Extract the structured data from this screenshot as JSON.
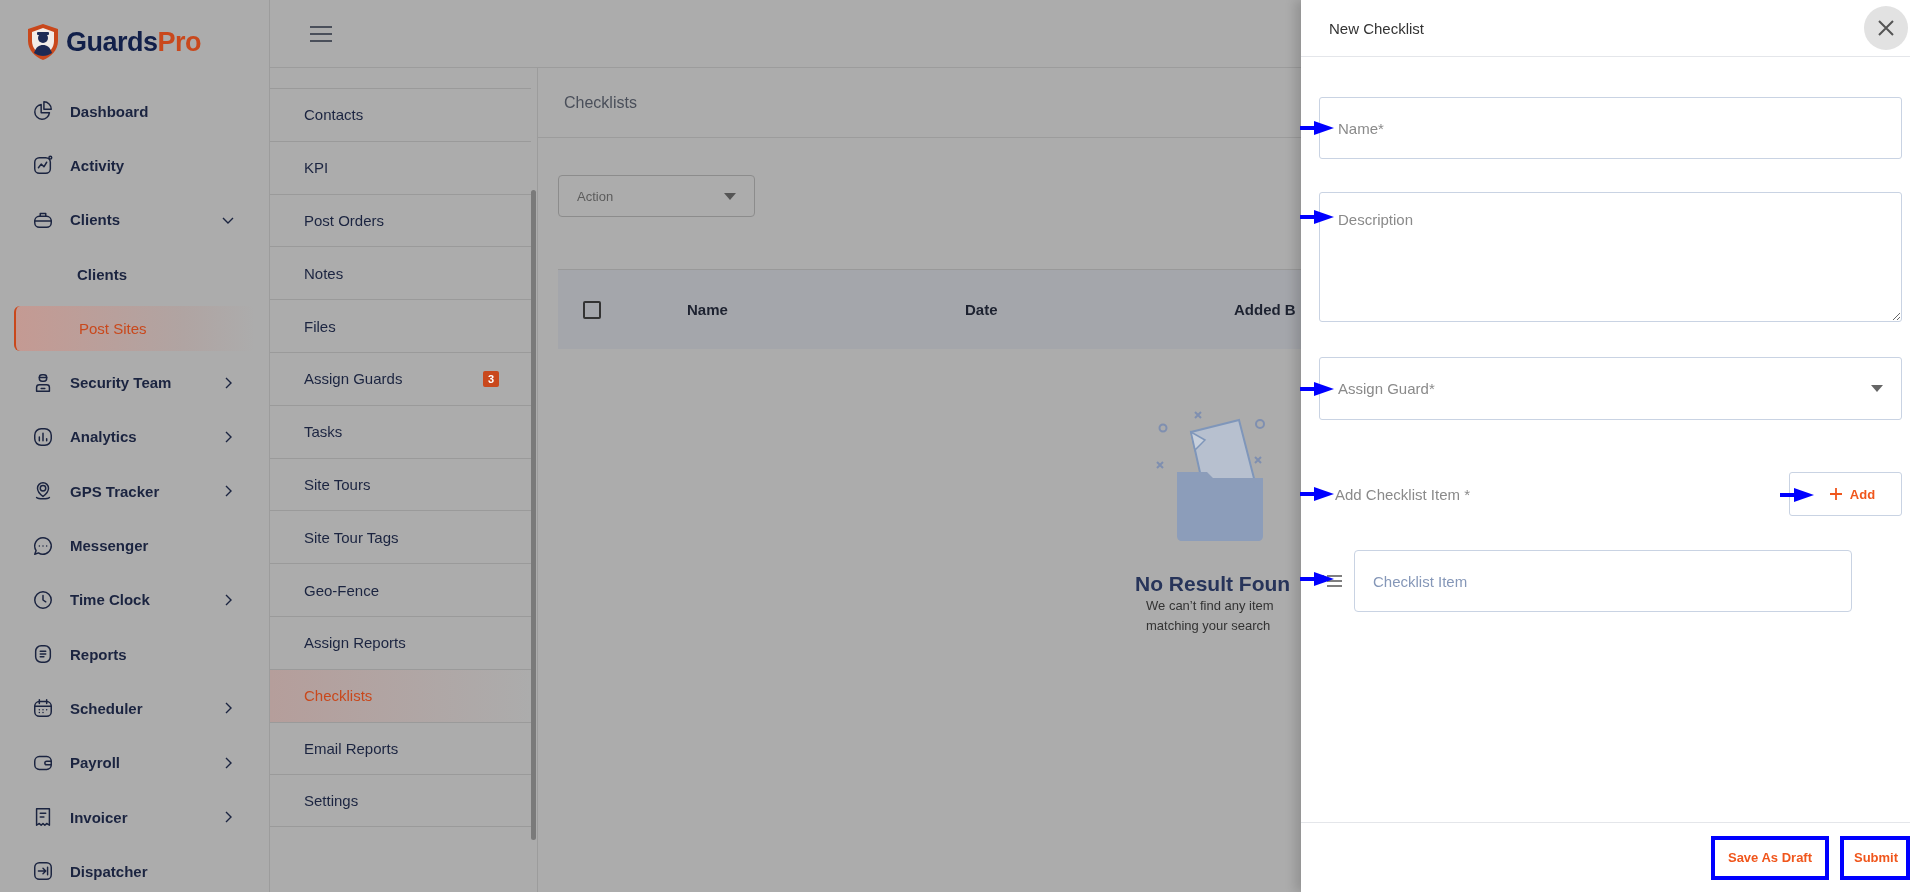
{
  "logo": {
    "name_part": "Guards",
    "accent_part": "Pro"
  },
  "sidebar": {
    "items": [
      {
        "label": "Dashboard",
        "selected": false
      },
      {
        "label": "Activity",
        "selected": false
      },
      {
        "label": "Clients",
        "selected": false,
        "expanded": true,
        "children": [
          {
            "label": "Clients",
            "selected": false
          },
          {
            "label": "Post Sites",
            "selected": true
          }
        ]
      },
      {
        "label": "Security Team",
        "selected": false,
        "expanded": false
      },
      {
        "label": "Analytics",
        "selected": false,
        "expanded": false
      },
      {
        "label": "GPS Tracker",
        "selected": false,
        "expanded": false
      },
      {
        "label": "Messenger",
        "selected": false
      },
      {
        "label": "Time Clock",
        "selected": false,
        "expanded": false
      },
      {
        "label": "Reports",
        "selected": false
      },
      {
        "label": "Scheduler",
        "selected": false,
        "expanded": false
      },
      {
        "label": "Payroll",
        "selected": false,
        "expanded": false
      },
      {
        "label": "Invoicer",
        "selected": false,
        "expanded": false
      },
      {
        "label": "Dispatcher",
        "selected": false
      }
    ]
  },
  "subnav": {
    "items": [
      {
        "label": "Contacts",
        "selected": false
      },
      {
        "label": "KPI",
        "selected": false
      },
      {
        "label": "Post Orders",
        "selected": false
      },
      {
        "label": "Notes",
        "selected": false
      },
      {
        "label": "Files",
        "selected": false
      },
      {
        "label": "Assign Guards",
        "selected": false,
        "badge": "3"
      },
      {
        "label": "Tasks",
        "selected": false
      },
      {
        "label": "Site Tours",
        "selected": false
      },
      {
        "label": "Site Tour Tags",
        "selected": false
      },
      {
        "label": "Geo-Fence",
        "selected": false
      },
      {
        "label": "Assign Reports",
        "selected": false
      },
      {
        "label": "Checklists",
        "selected": true
      },
      {
        "label": "Email Reports",
        "selected": false
      },
      {
        "label": "Settings",
        "selected": false
      }
    ]
  },
  "main": {
    "title": "Checklists",
    "action_dropdown": {
      "value": "Action"
    },
    "table": {
      "select_all": {
        "checked": false
      },
      "columns": [
        "Name",
        "Date",
        "Added B"
      ]
    },
    "empty_state": {
      "title": "No Result Foun",
      "lines": [
        "We can’t find any item",
        "matching your search"
      ]
    }
  },
  "drawer": {
    "title": "New Checklist",
    "fields": [
      {
        "kind": "text",
        "placeholder": "Name*",
        "arrow": true
      },
      {
        "kind": "textarea",
        "placeholder": "Description",
        "arrow": true
      },
      {
        "kind": "select",
        "placeholder": "Assign Guard*",
        "arrow": true
      }
    ],
    "item_section": {
      "label": "Add Checklist Item *",
      "arrow": true,
      "add_button": {
        "label": "Add",
        "arrow": true
      },
      "items": [
        {
          "placeholder": "Checklist Item",
          "arrow": true
        }
      ]
    },
    "buttons": [
      {
        "label": "Save As Draft",
        "highlighted": true
      },
      {
        "label": "Submit",
        "highlighted": true
      }
    ]
  }
}
